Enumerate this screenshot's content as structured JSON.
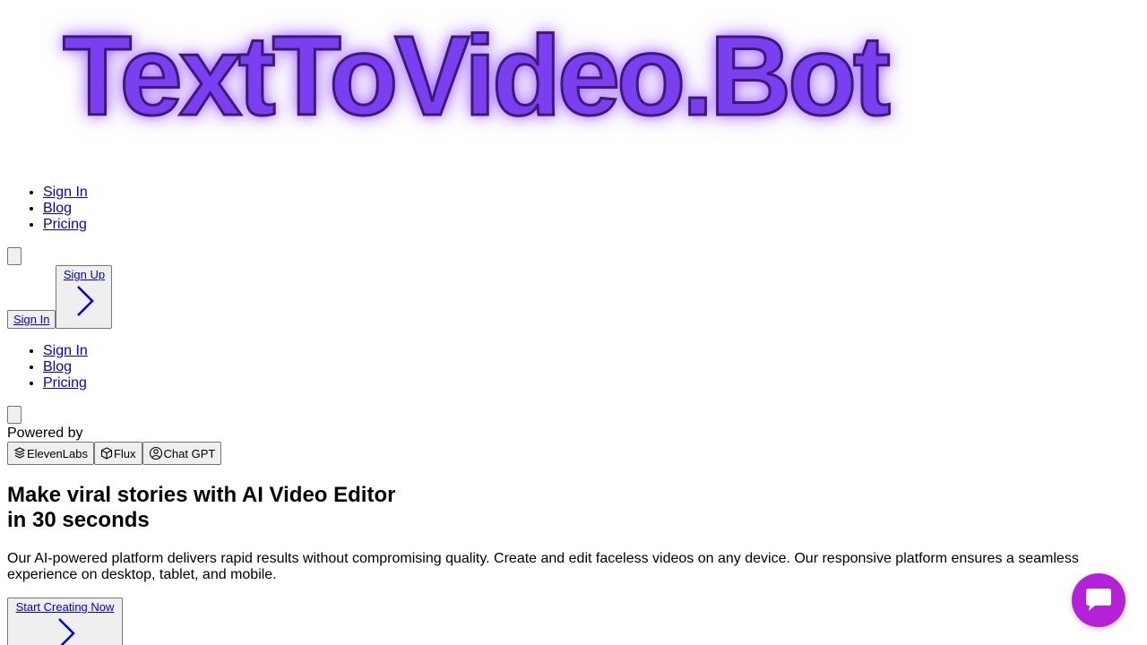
{
  "logo": {
    "text": "TextToVideo.Bot"
  },
  "nav_primary": [
    {
      "label": "Sign In"
    },
    {
      "label": "Blog"
    },
    {
      "label": "Pricing"
    }
  ],
  "auth": {
    "sign_in_label": "Sign In",
    "sign_up_label": "Sign Up"
  },
  "nav_secondary": [
    {
      "label": "Sign In"
    },
    {
      "label": "Blog"
    },
    {
      "label": "Pricing"
    }
  ],
  "powered": {
    "label": "Powered by",
    "partners": [
      {
        "label": "ElevenLabs",
        "icon": "elevenlabs-icon"
      },
      {
        "label": "Flux",
        "icon": "cube-icon"
      },
      {
        "label": "Chat GPT",
        "icon": "openai-icon"
      }
    ]
  },
  "hero": {
    "title_line1": "Make viral stories with AI Video Editor",
    "title_line2": "in 30 seconds",
    "description": "Our AI-powered platform delivers rapid results without compromising quality. Create and edit faceless videos on any device. Our responsive platform ensures a seamless experience on desktop, tablet, and mobile.",
    "cta_label": "Start Creating Now"
  },
  "colors": {
    "logo": "#7b3ff2",
    "link": "#0000ee",
    "chat_bubble": "#b521d9"
  }
}
